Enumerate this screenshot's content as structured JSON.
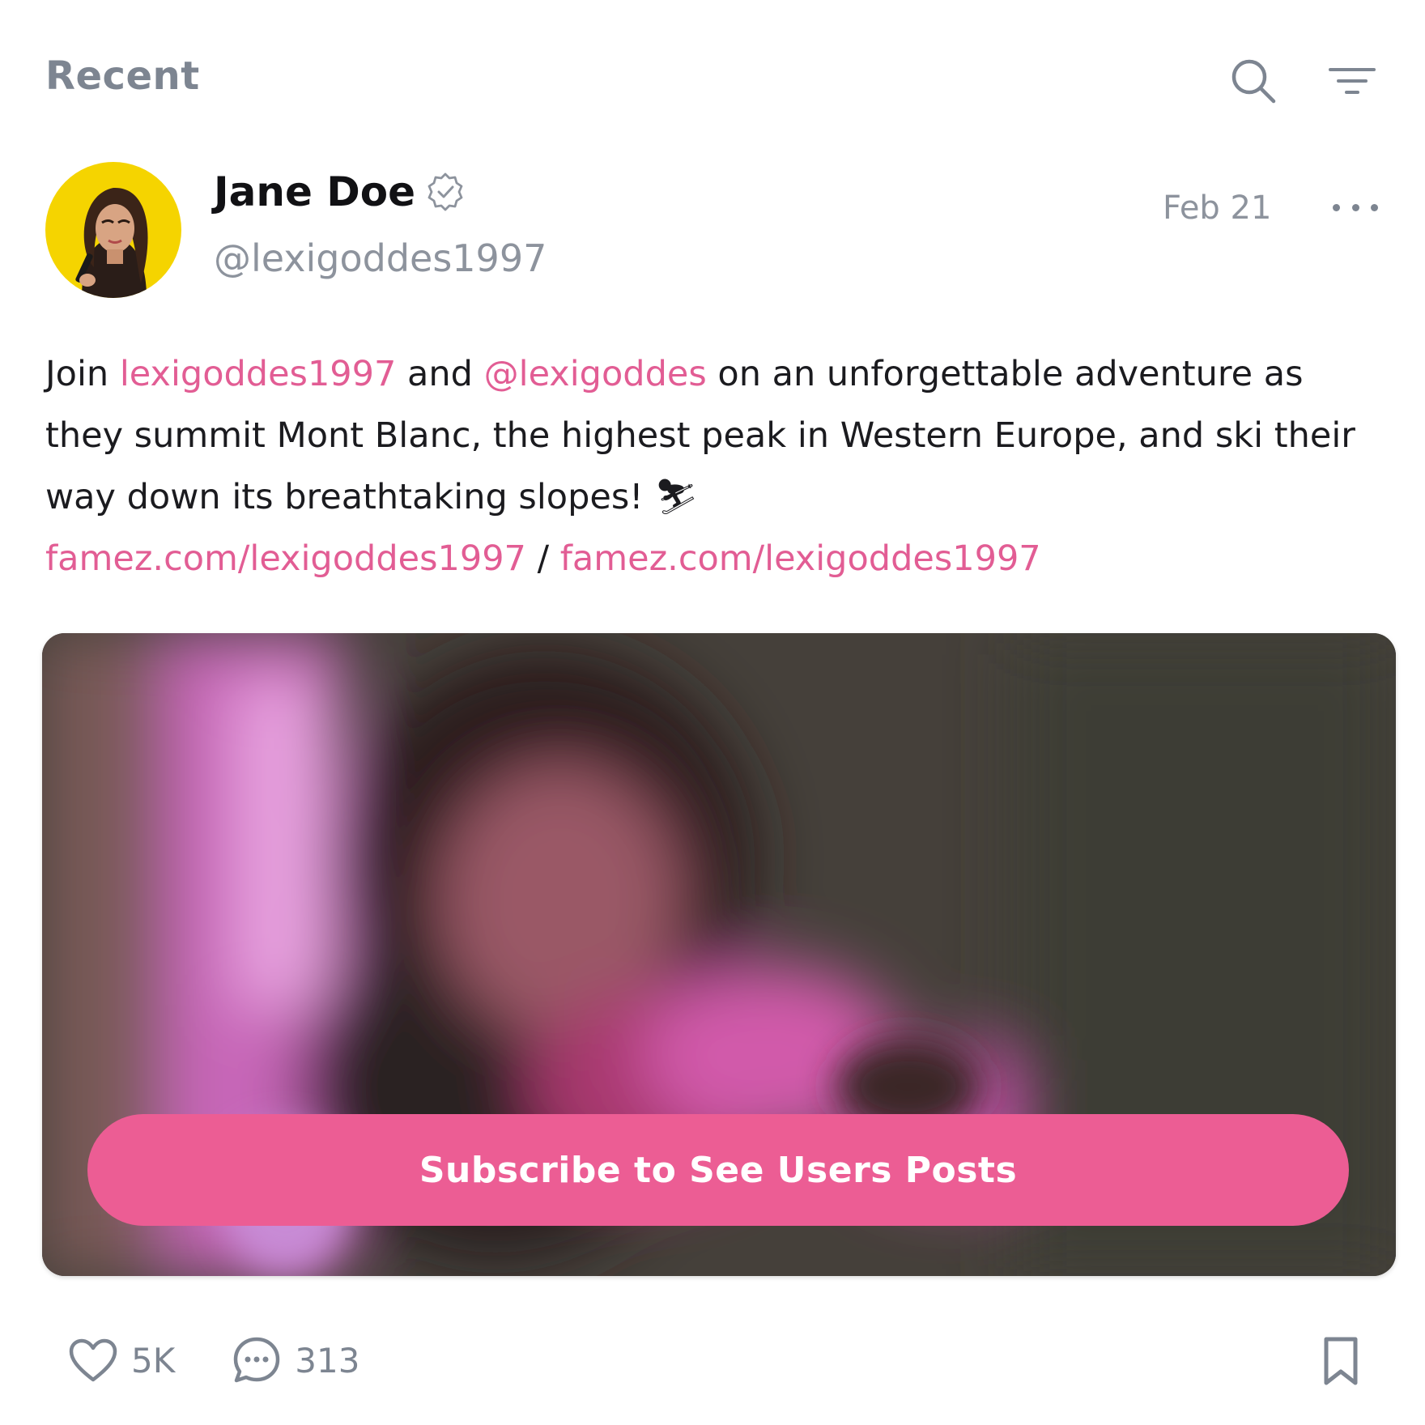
{
  "header": {
    "title": "Recent",
    "search_icon": "search-icon",
    "filter_icon": "filter-icon"
  },
  "post": {
    "author": {
      "name": "Jane Doe",
      "handle": "@lexigoddes1997",
      "verified": true,
      "avatar_bg": "#f5d400"
    },
    "date": "Feb 21",
    "body": {
      "p1": "Join ",
      "link1": "lexigoddes1997",
      "p2": " and ",
      "link2": "@lexigoddes",
      "p3": " on an unforgettable adventure as they summit Mont Blanc, the highest peak in Western Europe, and ski their way down its breathtaking slopes! ",
      "emoji": "⛷",
      "url1": "famez.com/lexigoddes1997",
      "sep": " / ",
      "url2": "famez.com/lexigoddes1997"
    },
    "media": {
      "locked": true,
      "subscribe_label": "Subscribe to See Users Posts"
    },
    "stats": {
      "likes": "5K",
      "comments": "313"
    }
  },
  "colors": {
    "accent": "#ec5d94",
    "link": "#e25d94",
    "muted": "#7d8591",
    "text": "#1b1b1f"
  }
}
